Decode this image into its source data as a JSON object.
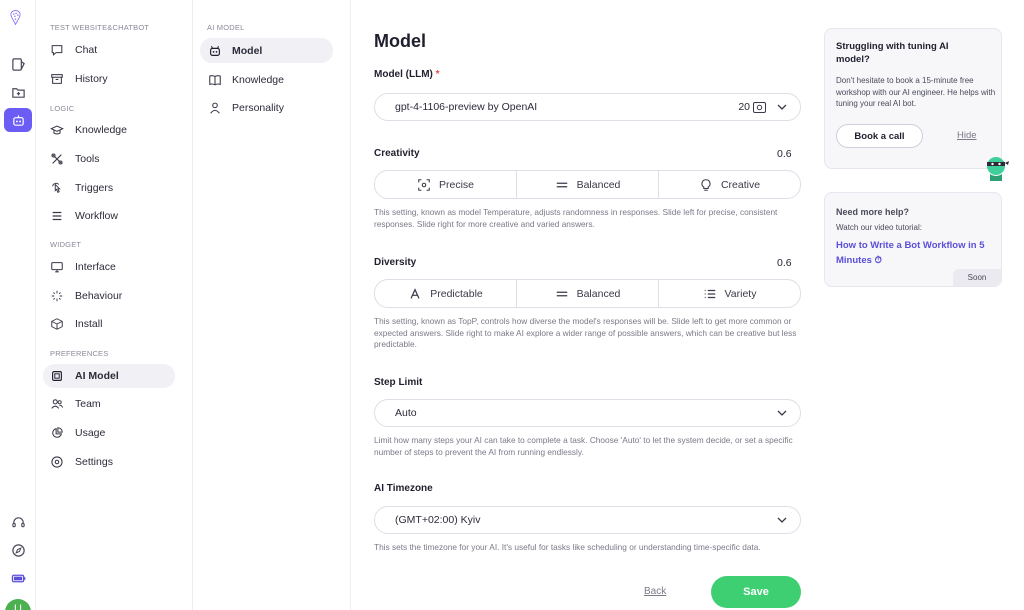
{
  "sidebar": {
    "sections": [
      {
        "title": "TEST WEBSITE&CHATBOT",
        "items": [
          {
            "label": "Chat",
            "icon": "chat-icon"
          },
          {
            "label": "History",
            "icon": "archive-icon"
          }
        ]
      },
      {
        "title": "LOGIC",
        "items": [
          {
            "label": "Knowledge",
            "icon": "graduation-cap-icon"
          },
          {
            "label": "Tools",
            "icon": "tools-icon"
          },
          {
            "label": "Triggers",
            "icon": "pointer-icon"
          },
          {
            "label": "Workflow",
            "icon": "workflow-icon"
          }
        ]
      },
      {
        "title": "WIDGET",
        "items": [
          {
            "label": "Interface",
            "icon": "monitor-icon"
          },
          {
            "label": "Behaviour",
            "icon": "sparkle-icon"
          },
          {
            "label": "Install",
            "icon": "cube-icon"
          }
        ]
      },
      {
        "title": "PREFERENCES",
        "items": [
          {
            "label": "AI Model",
            "icon": "chip-icon",
            "active": true
          },
          {
            "label": "Team",
            "icon": "team-icon"
          },
          {
            "label": "Usage",
            "icon": "pie-icon"
          },
          {
            "label": "Settings",
            "icon": "settings-icon"
          }
        ]
      }
    ]
  },
  "subnav": {
    "title": "AI MODEL",
    "items": [
      {
        "label": "Model",
        "icon": "robot-icon",
        "active": true
      },
      {
        "label": "Knowledge",
        "icon": "book-icon"
      },
      {
        "label": "Personality",
        "icon": "person-icon"
      }
    ]
  },
  "main": {
    "title": "Model",
    "model_label": "Model (LLM)",
    "required_mark": "*",
    "model_value": "gpt-4-1106-preview by OpenAI",
    "model_credits": "20",
    "creativity": {
      "label": "Creativity",
      "value": "0.6",
      "options": [
        "Precise",
        "Balanced",
        "Creative"
      ],
      "help": "This setting, known as model Temperature, adjusts randomness in responses. Slide left for precise, consistent responses. Slide right for more creative and varied answers."
    },
    "diversity": {
      "label": "Diversity",
      "value": "0.6",
      "options": [
        "Predictable",
        "Balanced",
        "Variety"
      ],
      "help": "This setting, known as TopP, controls how diverse the model's responses will be. Slide left to get more common or expected answers. Slide right to make AI explore a wider range of possible answers, which can be creative but less predictable."
    },
    "step_limit": {
      "label": "Step Limit",
      "value": "Auto",
      "help": "Limit how many steps your AI can take to complete a task. Choose 'Auto' to let the system decide, or set a specific number of steps to prevent the AI from running endlessly."
    },
    "timezone": {
      "label": "AI Timezone",
      "value": "(GMT+02:00) Kyiv",
      "help": "This sets the timezone for your AI. It's useful for tasks like scheduling or understanding time-specific data."
    },
    "back_label": "Back",
    "save_label": "Save"
  },
  "promo": {
    "title": "Struggling with tuning AI model?",
    "text": "Don't hesitate to book a 15-minute free workshop with our AI engineer. He helps with tuning your real AI bot.",
    "book_label": "Book a call",
    "hide_label": "Hide"
  },
  "help_card": {
    "title": "Need more help?",
    "text": "Watch our video tutorial:",
    "link": "How to Write a Bot Workflow in 5 Minutes",
    "badge": "Soon"
  },
  "user": {
    "avatar_initial": "U"
  },
  "colors": {
    "accent": "#6b5cf6",
    "save": "#3ecf73",
    "link": "#5a4fd6"
  }
}
